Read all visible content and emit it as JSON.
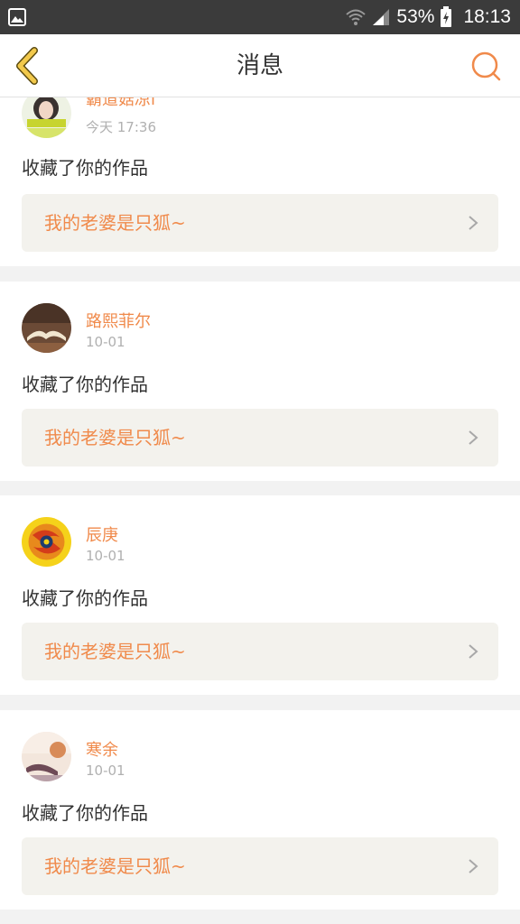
{
  "status_bar": {
    "battery": "53%",
    "time": "18:13",
    "icons": [
      "gallery-icon",
      "wifi-icon",
      "signal-icon",
      "battery-icon"
    ]
  },
  "header": {
    "title": "消息",
    "back_icon": "chevron-left-icon",
    "search_icon": "search-icon"
  },
  "colors": {
    "accent": "#f08a4b",
    "back_arrow": "#f2c94c",
    "status_bar_bg": "#3b3b3b",
    "card_box_bg": "#f3f2ed"
  },
  "messages": [
    {
      "user": "霸道菇凉i",
      "time": "今天 17:36",
      "action": "收藏了你的作品",
      "work_title": "我的老婆是只狐~"
    },
    {
      "user": "路熙菲尔",
      "time": "10-01",
      "action": "收藏了你的作品",
      "work_title": "我的老婆是只狐~"
    },
    {
      "user": "辰庚",
      "time": "10-01",
      "action": "收藏了你的作品",
      "work_title": "我的老婆是只狐~"
    },
    {
      "user": "寒余",
      "time": "10-01",
      "action": "收藏了你的作品",
      "work_title": "我的老婆是只狐~"
    }
  ]
}
